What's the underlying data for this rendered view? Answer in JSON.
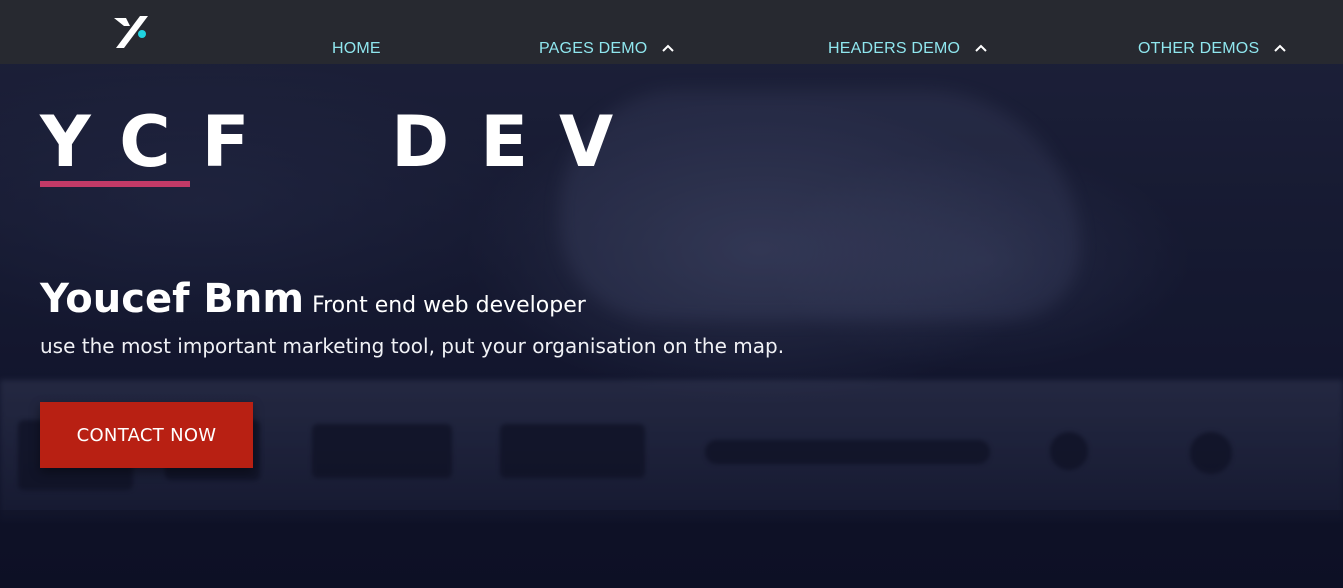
{
  "nav": {
    "logo_icon": "ycf-logo-icon",
    "items": [
      {
        "label": "HOME",
        "has_dropdown": false
      },
      {
        "label": "PAGES DEMO",
        "has_dropdown": true
      },
      {
        "label": "HEADERS DEMO",
        "has_dropdown": true
      },
      {
        "label": "OTHER DEMOS",
        "has_dropdown": true
      }
    ]
  },
  "hero": {
    "brand": "YCF  DEV",
    "name": "Youcef Bnm",
    "role": "Front end web developer",
    "tagline": "use the most important marketing tool, put your organisation on the map.",
    "cta_label": "CONTACT NOW"
  },
  "colors": {
    "nav_text": "#8fe6ee",
    "accent_underline": "#c23a67",
    "cta_background": "#b82013",
    "logo_dot": "#1fd3e0"
  }
}
